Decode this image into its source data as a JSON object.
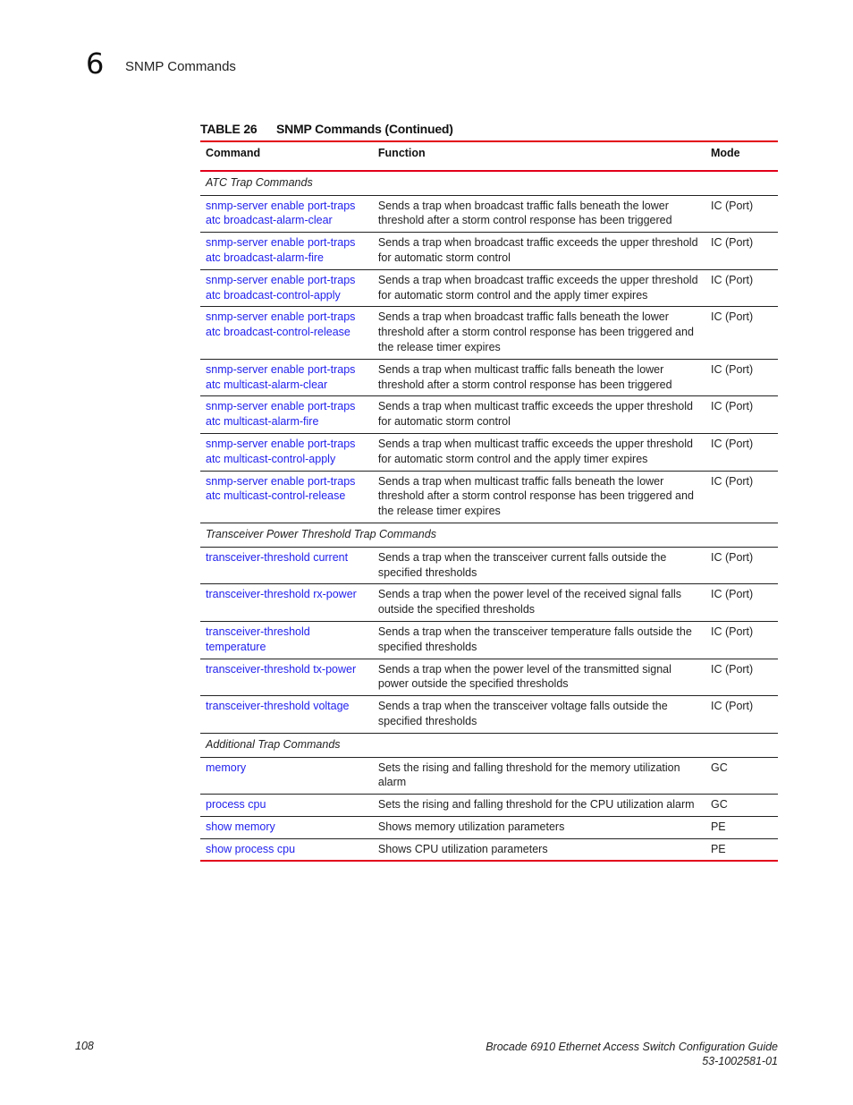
{
  "header": {
    "chapter_number": "6",
    "chapter_title": "SNMP Commands"
  },
  "table": {
    "caption_number": "TABLE 26",
    "caption_title": "SNMP Commands (Continued)",
    "columns": [
      "Command",
      "Function",
      "Mode"
    ],
    "sections": [
      {
        "title": "ATC Trap Commands",
        "rows": [
          {
            "command": "snmp-server enable port-traps atc broadcast-alarm-clear",
            "function": "Sends a trap when broadcast traffic falls beneath the lower threshold after a storm control response has been triggered",
            "mode": "IC (Port)"
          },
          {
            "command": "snmp-server enable port-traps atc broadcast-alarm-fire",
            "function": "Sends a trap when broadcast traffic exceeds the upper threshold for automatic storm control",
            "mode": "IC (Port)"
          },
          {
            "command": "snmp-server enable port-traps atc broadcast-control-apply",
            "function": "Sends a trap when broadcast traffic exceeds the upper threshold for automatic storm control and the apply timer expires",
            "mode": "IC (Port)"
          },
          {
            "command": "snmp-server enable port-traps atc broadcast-control-release",
            "function": "Sends a trap when broadcast traffic falls beneath the lower threshold after a storm control response has been triggered and the release timer expires",
            "mode": "IC (Port)"
          },
          {
            "command": "snmp-server enable port-traps atc multicast-alarm-clear",
            "function": "Sends a trap when multicast traffic falls beneath the lower threshold after a storm control response has been triggered",
            "mode": "IC (Port)"
          },
          {
            "command": "snmp-server enable port-traps atc multicast-alarm-fire",
            "function": "Sends a trap when multicast traffic exceeds the upper threshold for automatic storm control",
            "mode": "IC (Port)"
          },
          {
            "command": "snmp-server enable port-traps atc multicast-control-apply",
            "function": "Sends a trap when multicast traffic exceeds the upper threshold for automatic storm control and the apply timer expires",
            "mode": "IC (Port)"
          },
          {
            "command": "snmp-server enable port-traps atc multicast-control-release",
            "function": "Sends a trap when multicast traffic falls beneath the lower threshold after a storm control response has been triggered and the release timer expires",
            "mode": "IC (Port)"
          }
        ]
      },
      {
        "title": "Transceiver Power Threshold Trap Commands",
        "rows": [
          {
            "command": "transceiver-threshold current",
            "function": "Sends a trap when the transceiver current falls outside the specified thresholds",
            "mode": "IC (Port)"
          },
          {
            "command": "transceiver-threshold rx-power",
            "function": "Sends a trap when the power level of the received signal falls outside the specified thresholds",
            "mode": "IC (Port)"
          },
          {
            "command": "transceiver-threshold temperature",
            "function": "Sends a trap when the transceiver temperature falls outside the specified thresholds",
            "mode": "IC (Port)"
          },
          {
            "command": "transceiver-threshold tx-power",
            "function": "Sends a trap when the power level of the transmitted signal power outside the specified thresholds",
            "mode": "IC (Port)"
          },
          {
            "command": "transceiver-threshold voltage",
            "function": "Sends a trap when the transceiver voltage falls outside the specified thresholds",
            "mode": "IC (Port)"
          }
        ]
      },
      {
        "title": "Additional Trap Commands",
        "rows": [
          {
            "command": "memory",
            "function": "Sets the rising and falling threshold for the memory utilization alarm",
            "mode": "GC"
          },
          {
            "command": "process cpu",
            "function": "Sets the rising and falling threshold for the CPU utilization alarm",
            "mode": "GC"
          },
          {
            "command": "show memory",
            "function": "Shows memory utilization parameters",
            "mode": "PE"
          },
          {
            "command": "show process cpu",
            "function": "Shows CPU utilization parameters",
            "mode": "PE"
          }
        ]
      }
    ]
  },
  "footer": {
    "page_number": "108",
    "guide_title": "Brocade 6910 Ethernet Access Switch Configuration Guide",
    "doc_number": "53-1002581-01"
  },
  "colors": {
    "accent_rule": "#e2001a",
    "link": "#2222ee"
  }
}
